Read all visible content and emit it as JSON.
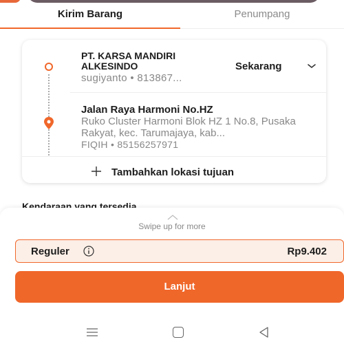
{
  "tabs": [
    {
      "label": "Kirim Barang",
      "active": true
    },
    {
      "label": "Penumpang",
      "active": false
    }
  ],
  "route": {
    "origin": {
      "name": "PT. KARSA MANDIRI ALKESINDO",
      "contact": "sugiyanto • 813867..."
    },
    "pickup_time": "Sekarang",
    "destination": {
      "name": "Jalan Raya Harmoni No.HZ",
      "address": "Ruko Cluster Harmoni Blok HZ 1 No.8, Pusaka Rakyat, kec. Tarumajaya, kab...",
      "contact": "FIQIH • 85156257971"
    },
    "add_destination_label": "Tambahkan lokasi tujuan"
  },
  "vehicles_title": "Kendaraan yang tersedia",
  "sheet": {
    "swipe_hint": "Swipe up for more",
    "service": {
      "name": "Reguler",
      "price": "Rp9.402",
      "selected": true
    },
    "next_label": "Lanjut"
  },
  "colors": {
    "accent": "#f0672a",
    "selected_bg": "#fcefe7",
    "text_primary": "#1d1d1d",
    "text_secondary": "#888888"
  },
  "icons": {
    "origin": "origin-circle-icon",
    "destination": "location-pin-icon",
    "dropdown": "chevron-down-icon",
    "add": "plus-icon",
    "info": "info-circle-icon",
    "nav_menu": "menu-icon",
    "nav_home": "home-square-icon",
    "nav_back": "back-triangle-icon"
  }
}
